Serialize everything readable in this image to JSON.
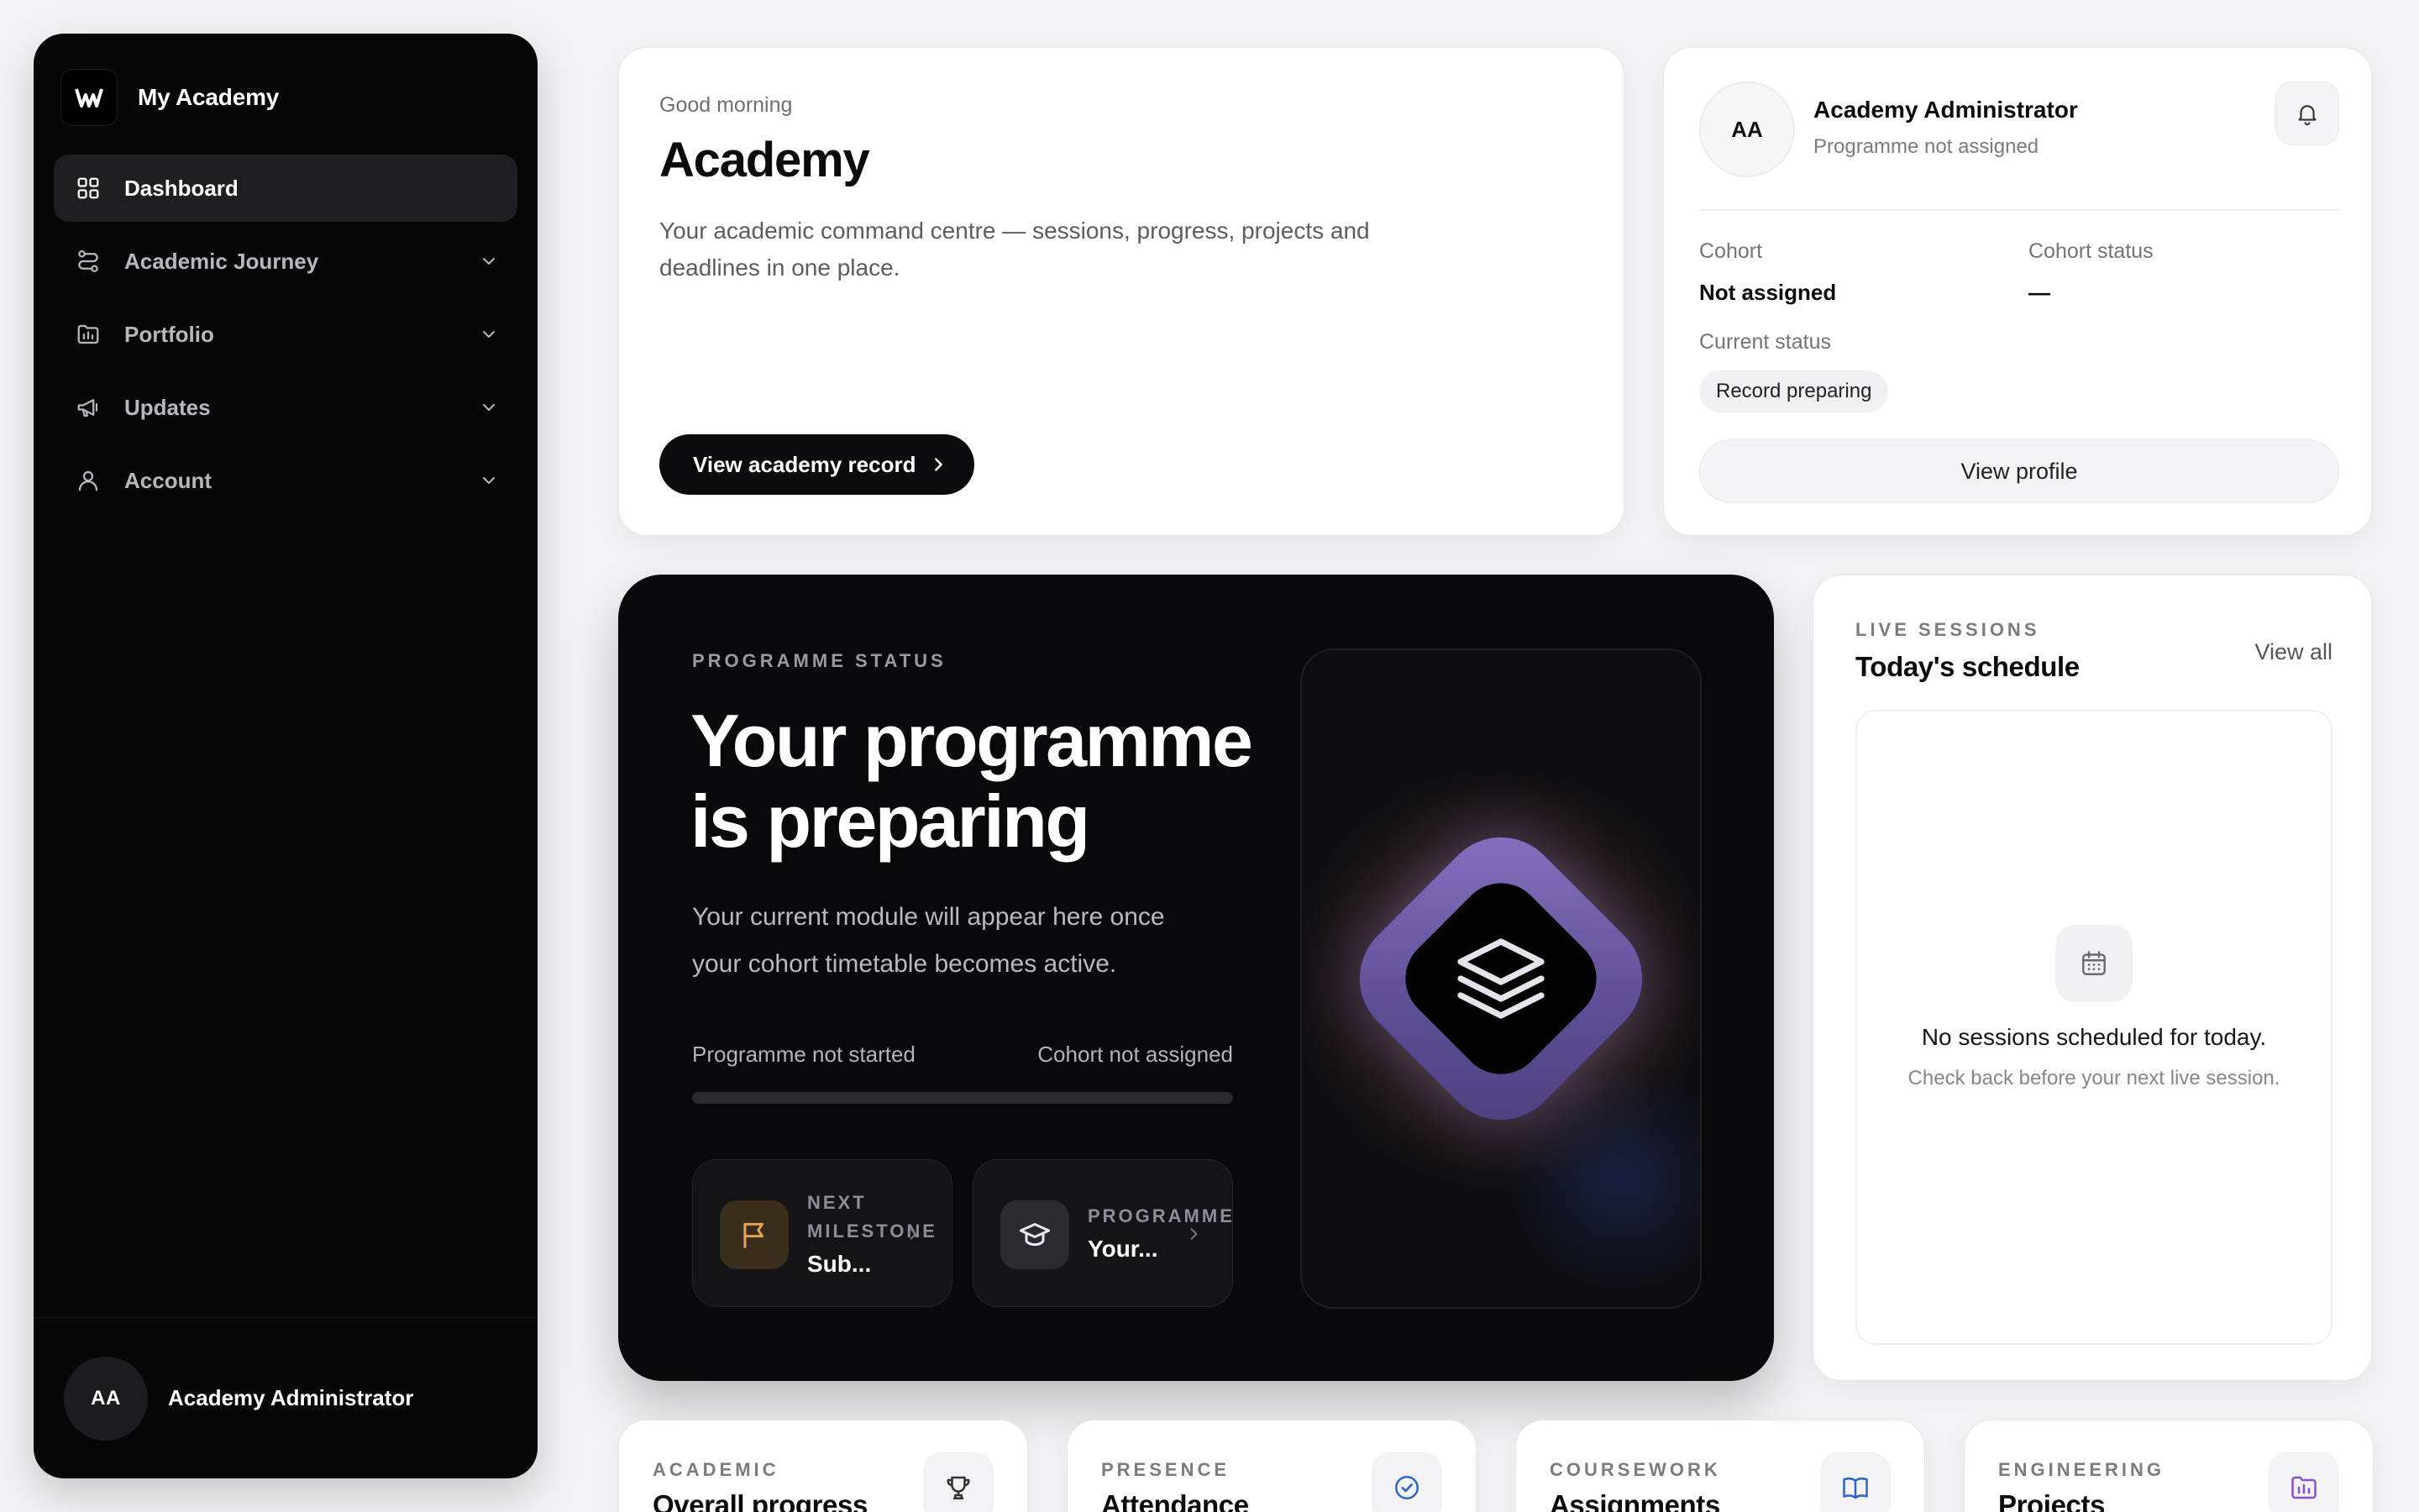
{
  "brand": {
    "name": "My Academy"
  },
  "sidebar": {
    "items": [
      {
        "label": "Dashboard",
        "icon": "grid-icon",
        "active": true
      },
      {
        "label": "Academic Journey",
        "icon": "route-icon"
      },
      {
        "label": "Portfolio",
        "icon": "folder-icon"
      },
      {
        "label": "Updates",
        "icon": "megaphone-icon"
      },
      {
        "label": "Account",
        "icon": "user-icon"
      }
    ],
    "user": {
      "initials": "AA",
      "name": "Academy Administrator"
    }
  },
  "welcome": {
    "greeting": "Good morning",
    "title": "Academy",
    "description": "Your academic command centre — sessions, progress, projects and deadlines in one place.",
    "button": "View academy record"
  },
  "profile": {
    "initials": "AA",
    "name": "Academy Administrator",
    "programme": "Programme not assigned",
    "cohort_label": "Cohort",
    "cohort_value": "Not assigned",
    "cohort_status_label": "Cohort status",
    "cohort_status_value": "—",
    "current_status_label": "Current status",
    "current_status_value": "Record preparing",
    "button": "View profile"
  },
  "hero": {
    "eyebrow": "PROGRAMME STATUS",
    "title": "Your programme is preparing",
    "description": "Your current module will appear here once your cohort timetable becomes active.",
    "progress_left": "Programme not started",
    "progress_right": "Cohort not assigned",
    "progress_value": 0,
    "milestone": {
      "eyebrow": "NEXT MILESTONE",
      "value": "Sub..."
    },
    "programme": {
      "eyebrow": "PROGRAMME",
      "value": "Your..."
    }
  },
  "live": {
    "eyebrow": "LIVE SESSIONS",
    "title": "Today's schedule",
    "link": "View all",
    "empty_title": "No sessions scheduled for today.",
    "empty_desc": "Check back before your next live session."
  },
  "stats": [
    {
      "eyebrow": "ACADEMIC",
      "title": "Overall progress",
      "icon": "trophy-icon"
    },
    {
      "eyebrow": "PRESENCE",
      "title": "Attendance",
      "icon": "check-circle-icon"
    },
    {
      "eyebrow": "COURSEWORK",
      "title": "Assignments",
      "icon": "book-icon"
    },
    {
      "eyebrow": "ENGINEERING",
      "title": "Projects",
      "icon": "folder-chart-icon"
    }
  ],
  "colors": {
    "sidebar_bg": "#070708",
    "hero_bg": "#09090b",
    "accent_purple": "#7b64b8",
    "accent_gold": "#c4923e",
    "page_bg": "#f3f3f5"
  }
}
